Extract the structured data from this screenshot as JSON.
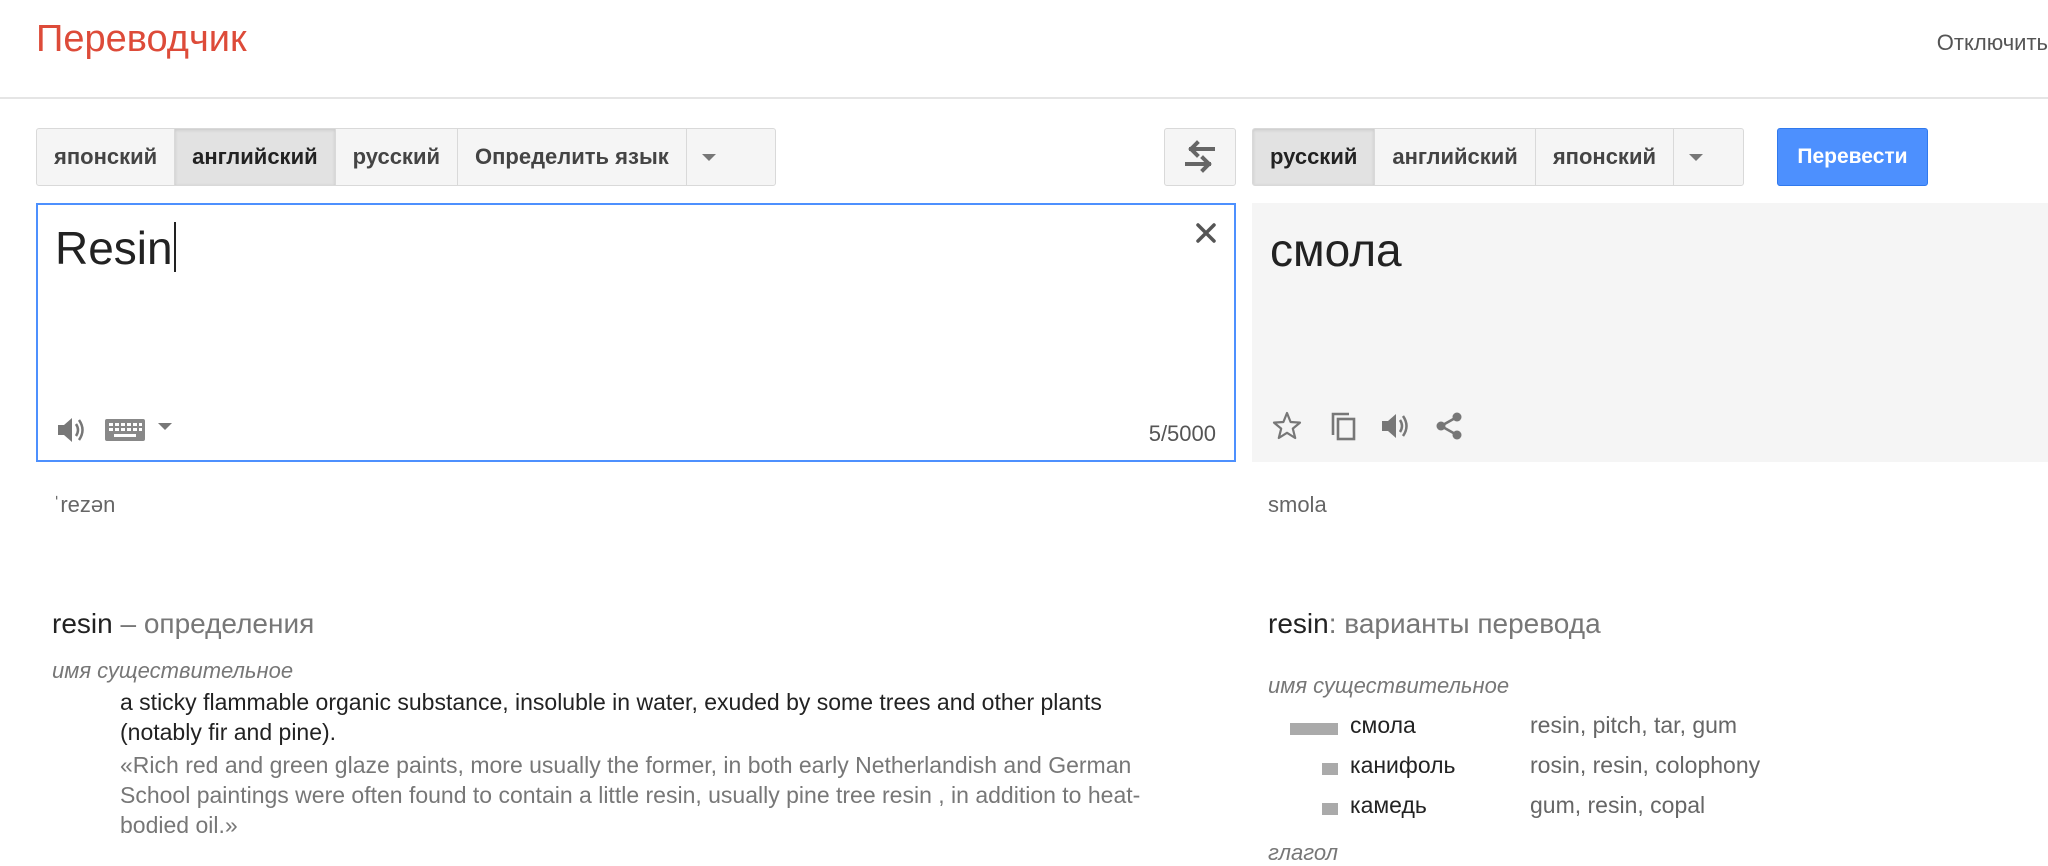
{
  "header": {
    "logo": "Переводчик",
    "signout": "Отключить"
  },
  "source_langs": {
    "items": [
      {
        "label": "японский",
        "selected": false
      },
      {
        "label": "английский",
        "selected": true
      },
      {
        "label": "русский",
        "selected": false
      },
      {
        "label": "Определить язык",
        "selected": false
      }
    ]
  },
  "target_langs": {
    "items": [
      {
        "label": "русский",
        "selected": true
      },
      {
        "label": "английский",
        "selected": false
      },
      {
        "label": "японский",
        "selected": false
      }
    ]
  },
  "translate_button": "Перевести",
  "source": {
    "text": "Resin",
    "char_count": "5/5000",
    "transliteration": "ˈrezən"
  },
  "result": {
    "text": "смола",
    "transliteration": "smola"
  },
  "definitions": {
    "word": "resin",
    "heading_suffix": " – определения",
    "pos": "имя существительное",
    "gloss": "a sticky flammable organic substance, insoluble in water, exuded by some trees and other plants (notably fir and pine).",
    "example": "«Rich red and green glaze paints, more usually the former, in both early Netherlandish and German School paintings were often found to contain a little resin, usually pine tree resin , in addition to heat-bodied oil.»"
  },
  "translations": {
    "word": "resin",
    "heading_suffix": ": варианты перевода",
    "pos": "имя существительное",
    "rows": [
      {
        "word": "смола",
        "reverse": "resin, pitch, tar, gum",
        "frequency": 1.0
      },
      {
        "word": "канифоль",
        "reverse": "rosin, resin, colophony",
        "frequency": 0.33
      },
      {
        "word": "камедь",
        "reverse": "gum, resin, copal",
        "frequency": 0.33
      }
    ],
    "next_pos_partial": "глагол"
  },
  "colors": {
    "logo": "#dd4b39",
    "focus": "#4d90fe",
    "translate_button": "#4d90fe"
  },
  "icons": [
    "clear-icon",
    "speaker-icon",
    "keyboard-icon",
    "swap-icon",
    "star-icon",
    "copy-icon",
    "share-icon",
    "chevron-down-icon"
  ]
}
